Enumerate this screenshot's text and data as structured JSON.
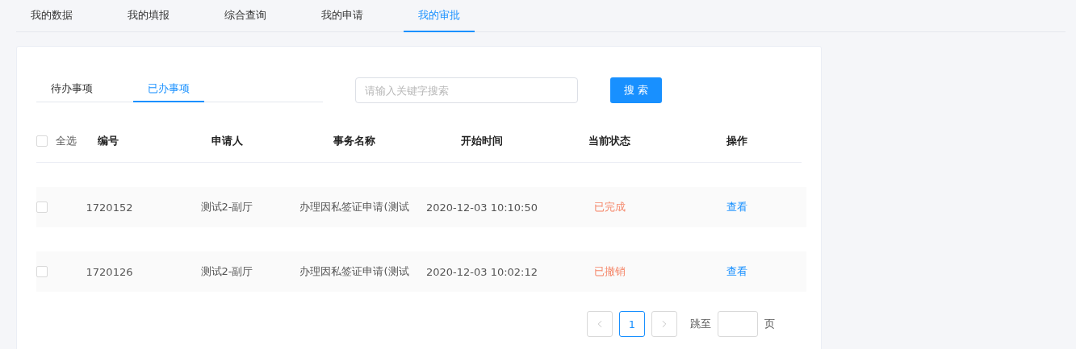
{
  "top_tabs": [
    {
      "label": "我的数据",
      "selected": false
    },
    {
      "label": "我的填报",
      "selected": false
    },
    {
      "label": "综合查询",
      "selected": false
    },
    {
      "label": "我的申请",
      "selected": false
    },
    {
      "label": "我的审批",
      "selected": true
    }
  ],
  "sub_tabs": [
    {
      "label": "待办事项",
      "selected": false
    },
    {
      "label": "已办事项",
      "selected": true
    }
  ],
  "search": {
    "placeholder": "请输入关键字搜索",
    "button": "搜 索"
  },
  "table": {
    "select_all": {
      "label": "全选",
      "checked": false
    },
    "columns": [
      "编号",
      "申请人",
      "事务名称",
      "开始时间",
      "当前状态",
      "操作"
    ],
    "rows": [
      {
        "checked": false,
        "id": "1720152",
        "applicant": "测试2-副厅",
        "title": "办理因私签证申请(测试",
        "start_time": "2020-12-03 10:10:50",
        "status": "已完成",
        "action": "查看"
      },
      {
        "checked": false,
        "id": "1720126",
        "applicant": "测试2-副厅",
        "title": "办理因私签证申请(测试",
        "start_time": "2020-12-03 10:02:12",
        "status": "已撤销",
        "action": "查看"
      }
    ]
  },
  "pagination": {
    "pages": [
      {
        "label": "1",
        "selected": true
      }
    ],
    "jump_label": "跳至",
    "page_suffix": "页"
  }
}
